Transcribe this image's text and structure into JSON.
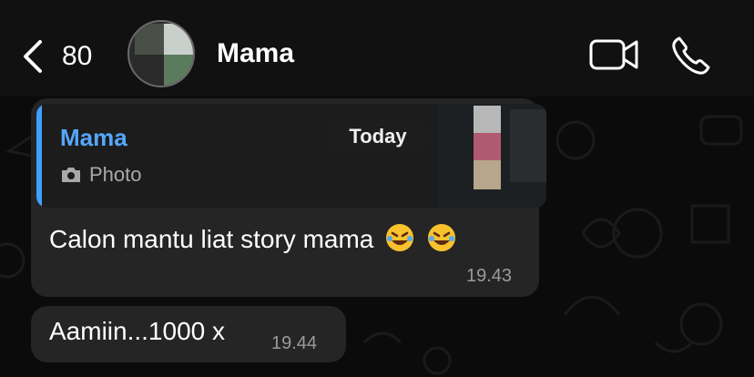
{
  "header": {
    "back_count": "80",
    "contact_name": "Mama",
    "icons": [
      "chevron-left-icon",
      "video-call-icon",
      "phone-icon"
    ]
  },
  "today_label": "Today",
  "messages": [
    {
      "reply": {
        "sender": "Mama",
        "type_label": "Photo",
        "icon": "camera-icon"
      },
      "text": "Calon mantu  liat story mama",
      "emojis": [
        "rolling-on-floor-laughing",
        "rolling-on-floor-laughing"
      ],
      "time": "19.43"
    },
    {
      "text": "Aamiin...1000 x",
      "time": "19.44"
    }
  ],
  "colors": {
    "accent": "#55a7ff",
    "bubble": "#252525",
    "background": "#0b0b0b"
  }
}
